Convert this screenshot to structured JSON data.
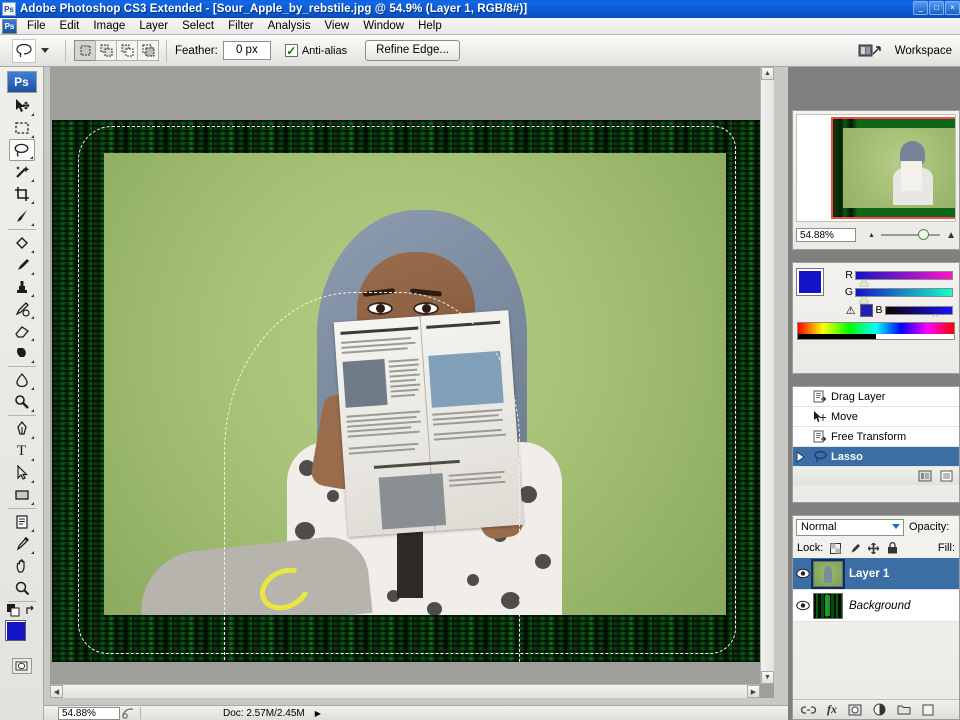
{
  "window": {
    "title": "Adobe Photoshop CS3 Extended - [Sour_Apple_by_rebstile.jpg @ 54.9% (Layer 1, RGB/8#)]",
    "app_icon": "Ps",
    "minimize": "_",
    "maximize": "□",
    "close": "×"
  },
  "menubar": {
    "app_icon": "Ps",
    "items": [
      {
        "label": "File"
      },
      {
        "label": "Edit"
      },
      {
        "label": "Image"
      },
      {
        "label": "Layer"
      },
      {
        "label": "Select"
      },
      {
        "label": "Filter"
      },
      {
        "label": "Analysis"
      },
      {
        "label": "View"
      },
      {
        "label": "Window"
      },
      {
        "label": "Help"
      }
    ]
  },
  "options_bar": {
    "tool_icon": "lasso-icon",
    "selection_modes": [
      {
        "name": "new-selection",
        "active": true
      },
      {
        "name": "add-to-selection",
        "active": false
      },
      {
        "name": "subtract-from-selection",
        "active": false
      },
      {
        "name": "intersect-with-selection",
        "active": false
      }
    ],
    "feather_label": "Feather:",
    "feather_value": "0 px",
    "antialias_label": "Anti-alias",
    "antialias_checked": true,
    "refine_edge_label": "Refine Edge...",
    "workspace_label": "Workspace"
  },
  "toolbox": {
    "logo": "Ps",
    "tools": [
      {
        "name": "move-tool",
        "active": false
      },
      {
        "name": "rectangular-marquee-tool",
        "active": false
      },
      {
        "name": "lasso-tool",
        "active": true
      },
      {
        "name": "magic-wand-tool",
        "active": false
      },
      {
        "name": "crop-tool",
        "active": false
      },
      {
        "name": "slice-tool",
        "active": false
      },
      {
        "name": "healing-brush-tool",
        "active": false
      },
      {
        "name": "brush-tool",
        "active": false
      },
      {
        "name": "clone-stamp-tool",
        "active": false
      },
      {
        "name": "history-brush-tool",
        "active": false
      },
      {
        "name": "eraser-tool",
        "active": false
      },
      {
        "name": "gradient-tool",
        "active": false
      },
      {
        "name": "blur-tool",
        "active": false
      },
      {
        "name": "dodge-tool",
        "active": false
      },
      {
        "name": "pen-tool",
        "active": false
      },
      {
        "name": "horizontal-type-tool",
        "active": false
      },
      {
        "name": "path-selection-tool",
        "active": false
      },
      {
        "name": "rectangle-shape-tool",
        "active": false
      },
      {
        "name": "notes-tool",
        "active": false
      },
      {
        "name": "eyedropper-tool",
        "active": false
      },
      {
        "name": "hand-tool",
        "active": false
      },
      {
        "name": "zoom-tool",
        "active": false
      }
    ],
    "foreground_color": "#1414c8",
    "background_color": "#ffffff",
    "type_glyph": "T"
  },
  "document": {
    "zoom_percent": "54.88%",
    "doc_size": "Doc: 2.57M/2.45M"
  },
  "navigator": {
    "zoom_value": "54.88%"
  },
  "color_panel": {
    "channels": [
      {
        "label": "R",
        "knob_pct": 6
      },
      {
        "label": "G",
        "knob_pct": 6
      },
      {
        "label": "B",
        "knob_pct": 72
      }
    ],
    "foreground_color": "#1414c8",
    "background_color": "#ffffff",
    "out_of_gamut_color": "#2020b4",
    "warning_glyph": "⚠"
  },
  "history_panel": {
    "states": [
      {
        "label": "Drag Layer",
        "icon": "drag-layer-icon",
        "selected": false
      },
      {
        "label": "Move",
        "icon": "move-icon",
        "selected": false
      },
      {
        "label": "Free Transform",
        "icon": "free-transform-icon",
        "selected": false
      },
      {
        "label": "Lasso",
        "icon": "lasso-icon",
        "selected": true
      }
    ],
    "footer_buttons": [
      {
        "name": "create-document-from-state-icon",
        "glyph": "▤"
      },
      {
        "name": "create-new-snapshot-icon",
        "glyph": "▣"
      }
    ]
  },
  "layers_panel": {
    "blend_mode": "Normal",
    "opacity_label": "Opacity:",
    "lock_label": "Lock:",
    "fill_label": "Fill:",
    "lock_buttons": [
      {
        "name": "lock-transparent-pixels-icon",
        "glyph": "▨"
      },
      {
        "name": "lock-image-pixels-icon",
        "glyph": "✎"
      },
      {
        "name": "lock-position-icon",
        "glyph": "✛"
      },
      {
        "name": "lock-all-icon",
        "glyph": "🔒"
      }
    ],
    "layers": [
      {
        "name": "Layer 1",
        "selected": true,
        "visible": true,
        "italic": false
      },
      {
        "name": "Background",
        "selected": false,
        "visible": true,
        "italic": true
      }
    ],
    "footer_buttons": [
      {
        "name": "link-layers-icon",
        "glyph": "⛓"
      },
      {
        "name": "layer-style-icon",
        "glyph": "fx"
      },
      {
        "name": "add-layer-mask-icon",
        "glyph": "▣"
      },
      {
        "name": "new-adjustment-layer-icon",
        "glyph": "◑"
      },
      {
        "name": "new-group-icon",
        "glyph": "▭"
      },
      {
        "name": "new-layer-icon",
        "glyph": "▢"
      }
    ]
  },
  "statusbar": {
    "zoom": "54.88%",
    "doc_info": "Doc: 2.57M/2.45M"
  }
}
